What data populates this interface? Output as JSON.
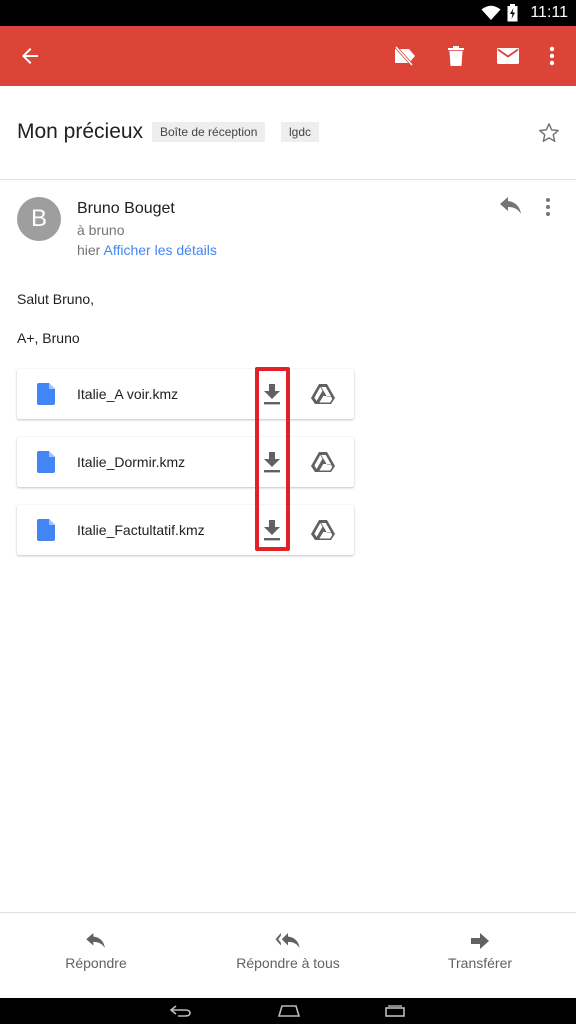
{
  "status_bar": {
    "time": "11:11",
    "icons": [
      "wifi-icon",
      "battery-icon"
    ]
  },
  "app_bar": {
    "icons": [
      "back-arrow-icon",
      "remove-label-icon",
      "delete-icon",
      "mark-unread-icon",
      "more-vert-icon"
    ],
    "color": "#db4437"
  },
  "email": {
    "subject": "Mon précieux",
    "labels": [
      "Boîte de réception",
      "lgdc"
    ],
    "sender": {
      "initial": "B",
      "name": "Bruno Bouget",
      "to": "à bruno",
      "when": "hier",
      "details_link": "Afficher les détails"
    },
    "body": [
      "Salut Bruno,",
      "A+, Bruno"
    ],
    "attachments": [
      {
        "name": "Italie_A voir.kmz"
      },
      {
        "name": "Italie_Dormir.kmz"
      },
      {
        "name": "Italie_Factultatif.kmz"
      }
    ]
  },
  "bottom_actions": [
    {
      "label": "Répondre",
      "icon": "reply-icon"
    },
    {
      "label": "Répondre à tous",
      "icon": "reply-all-icon"
    },
    {
      "label": "Transférer",
      "icon": "forward-icon"
    }
  ],
  "nav_bar": {
    "icons": [
      "nav-back-icon",
      "nav-home-icon",
      "nav-recents-icon"
    ]
  },
  "colors": {
    "accent": "#db4437",
    "link": "#4285f4",
    "highlight": "#e32028",
    "file_icon": "#4285f4"
  }
}
